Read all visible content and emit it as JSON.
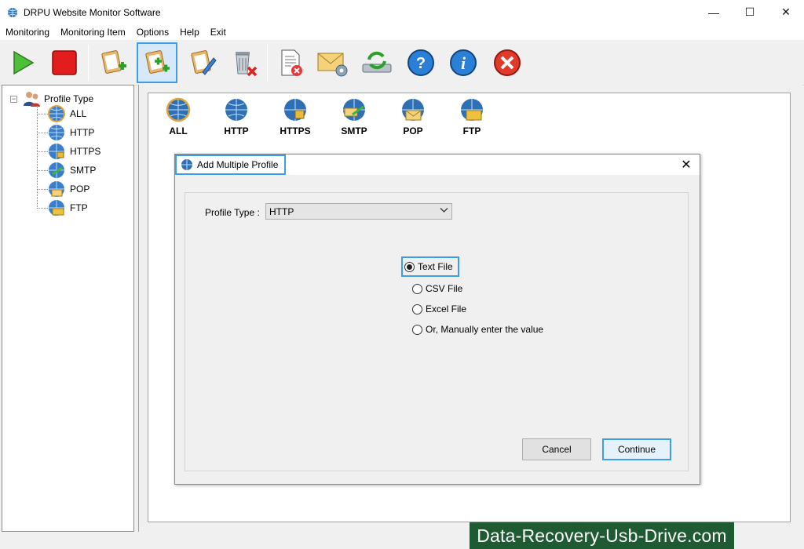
{
  "window": {
    "title": "DRPU Website Monitor Software",
    "min_label": "—",
    "max_label": "☐",
    "close_label": "✕"
  },
  "menu": [
    "Monitoring",
    "Monitoring Item",
    "Options",
    "Help",
    "Exit"
  ],
  "toolbar": {
    "buttons": [
      {
        "name": "start-monitoring-icon"
      },
      {
        "name": "stop-monitoring-icon"
      },
      {
        "name": "add-profile-icon"
      },
      {
        "name": "add-multiple-profile-icon",
        "active": true
      },
      {
        "name": "edit-profile-icon"
      },
      {
        "name": "delete-profile-icon"
      },
      {
        "name": "clear-log-icon"
      },
      {
        "name": "email-settings-icon"
      },
      {
        "name": "refresh-icon"
      },
      {
        "name": "help-icon"
      },
      {
        "name": "about-icon"
      },
      {
        "name": "exit-icon"
      }
    ]
  },
  "tree": {
    "root": "Profile Type",
    "expander": "−",
    "items": [
      "ALL",
      "HTTP",
      "HTTPS",
      "SMTP",
      "POP",
      "FTP"
    ]
  },
  "profile_types": [
    "ALL",
    "HTTP",
    "HTTPS",
    "SMTP",
    "POP",
    "FTP"
  ],
  "dialog": {
    "title": "Add Multiple Profile",
    "close_label": "✕",
    "profile_type_label": "Profile Type :",
    "profile_type_value": "HTTP",
    "options": [
      "Text File",
      "CSV File",
      "Excel File",
      "Or, Manually enter the value"
    ],
    "selected_option": "Text File",
    "cancel_label": "Cancel",
    "continue_label": "Continue"
  },
  "watermark": "Data-Recovery-Usb-Drive.com",
  "colors": {
    "accent": "#3c9ee8",
    "watermark_bg": "#1e5a32"
  }
}
